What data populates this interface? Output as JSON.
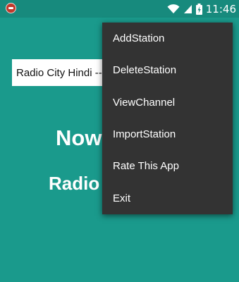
{
  "status_bar": {
    "time": "11:46",
    "icons": [
      "app-notification-icon",
      "wifi-icon",
      "signal-icon",
      "battery-charging-icon"
    ]
  },
  "main": {
    "station_field_value": "Radio City Hindi --- (",
    "now_text": "Now",
    "station_text": "Radio"
  },
  "overflow_menu": {
    "items": [
      {
        "label": "AddStation"
      },
      {
        "label": "DeleteStation"
      },
      {
        "label": "ViewChannel"
      },
      {
        "label": "ImportStation"
      },
      {
        "label": "Rate This App"
      },
      {
        "label": "Exit"
      }
    ]
  },
  "colors": {
    "background": "#1a9a8c",
    "status_bar": "#178a7d",
    "menu_background": "#333333",
    "text": "#ffffff"
  }
}
